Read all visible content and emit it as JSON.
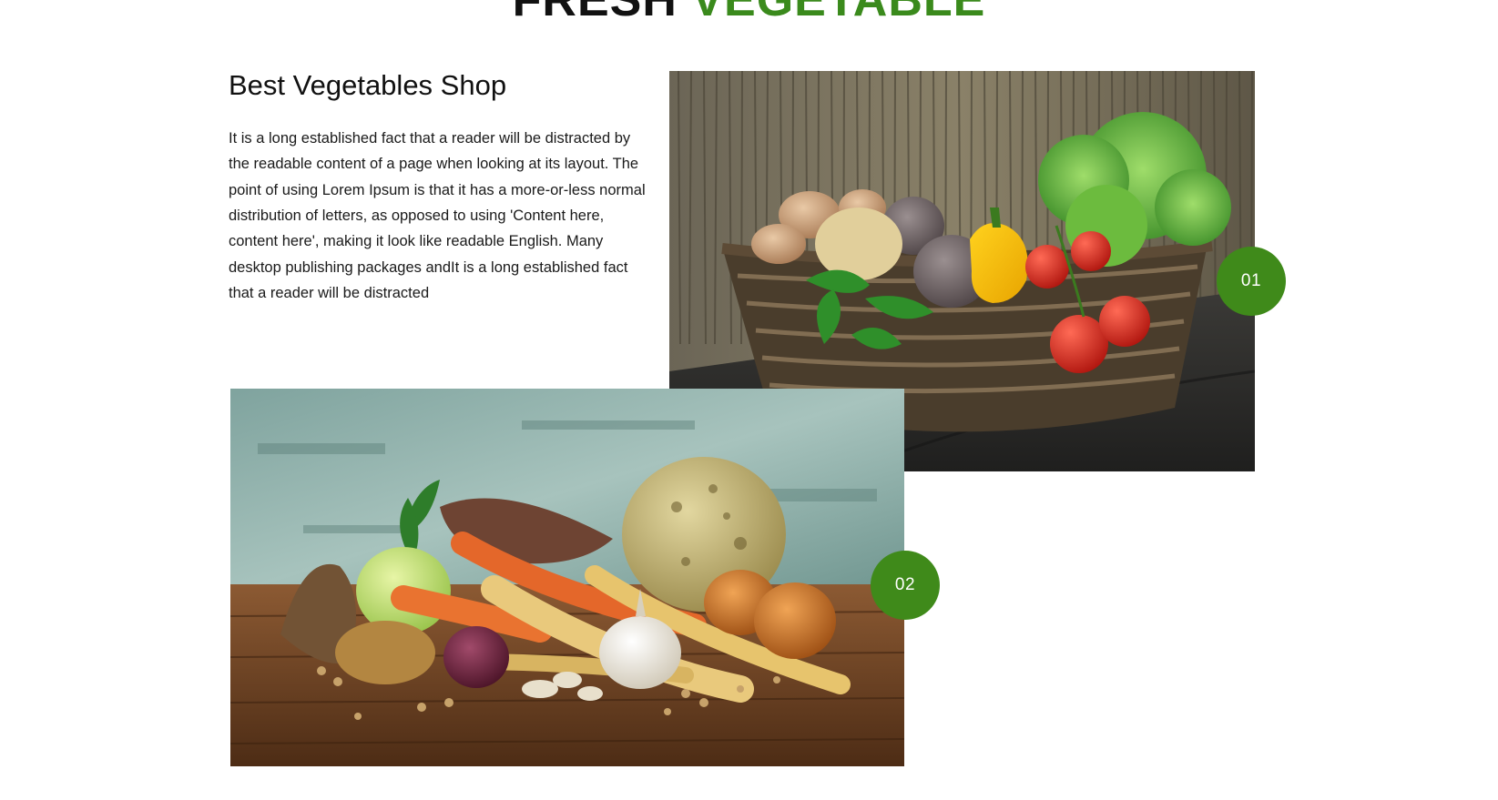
{
  "section_title": {
    "dark": "FRESH",
    "accent": "VEGETABLE"
  },
  "intro": {
    "heading": "Best Vegetables Shop",
    "body": "It is a long established fact that a reader will be distracted by the readable content of a page when looking at its layout. The point of using Lorem Ipsum is that it has a more-or-less normal distribution of letters, as opposed to using 'Content here, content here', making it look like readable English. Many desktop publishing packages andIt is a long established fact that a reader will be distracted"
  },
  "gallery": [
    {
      "number": "01"
    },
    {
      "number": "02"
    }
  ],
  "colors": {
    "accent": "#3a8a1c",
    "badge": "#3f8a1a",
    "text": "#111111",
    "background": "#ffffff"
  }
}
